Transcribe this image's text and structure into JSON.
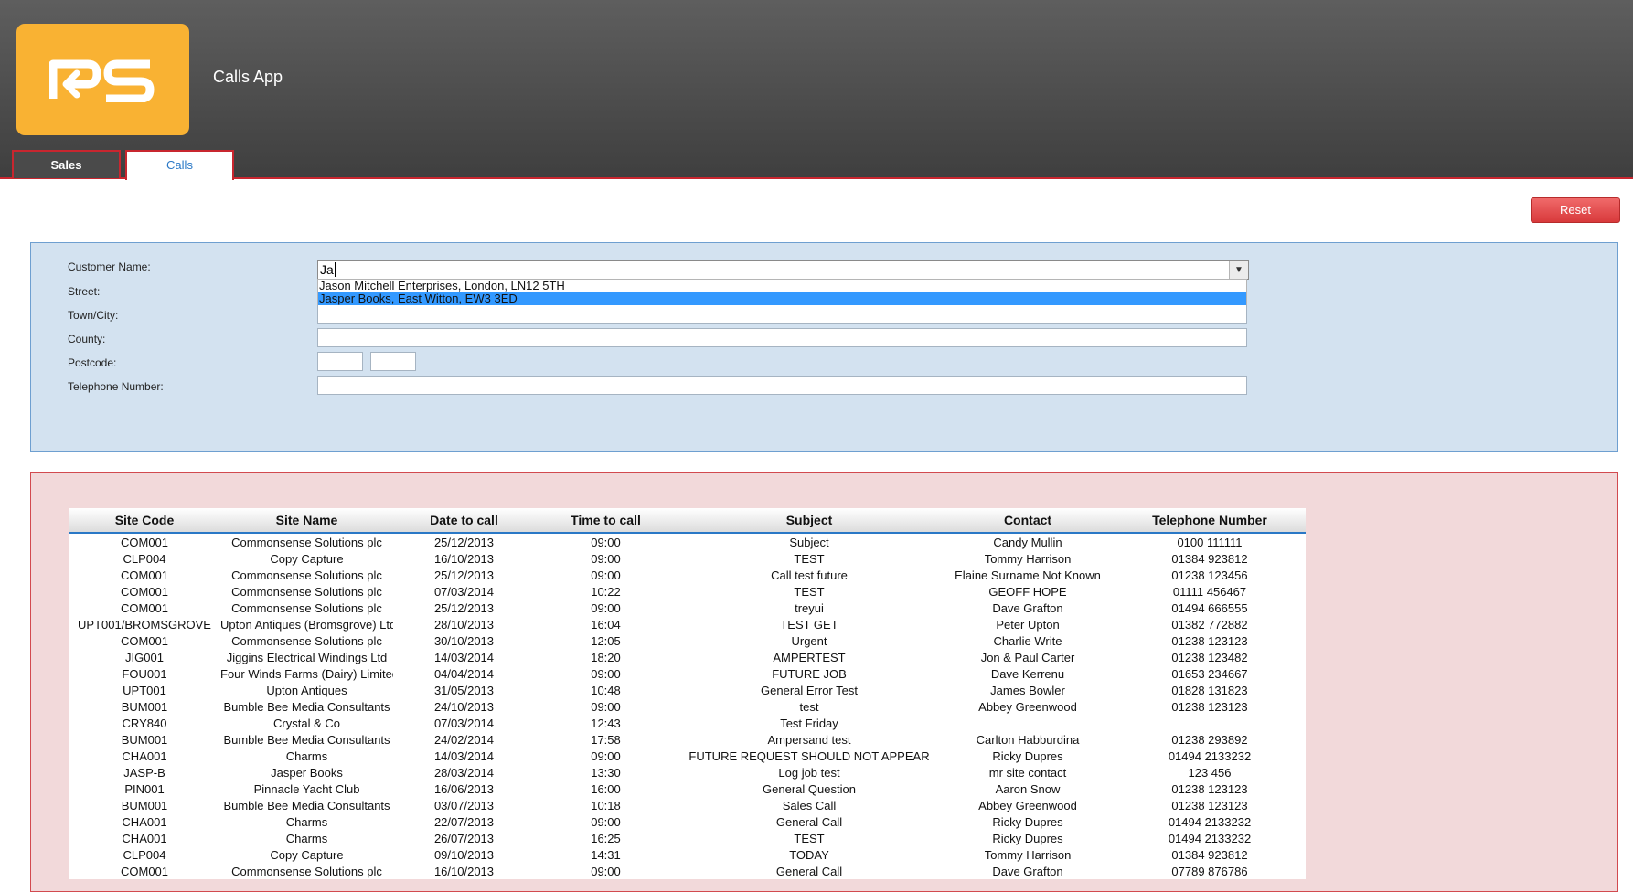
{
  "header": {
    "logo_text": "PS",
    "app_title": "Calls App",
    "brand_color": "#f9b233",
    "accent_color": "#c8262f"
  },
  "tabs": [
    {
      "label": "Sales",
      "active": false
    },
    {
      "label": "Calls",
      "active": true
    }
  ],
  "toolbar": {
    "reset_label": "Reset"
  },
  "form": {
    "customer_name_label": "Customer Name:",
    "customer_name_value": "Ja",
    "street_label": "Street:",
    "town_label": "Town/City:",
    "county_label": "County:",
    "postcode_label": "Postcode:",
    "telephone_label": "Telephone Number:",
    "dropdown_options": [
      {
        "text": "Jason Mitchell Enterprises, London, LN12 5TH",
        "selected": false
      },
      {
        "text": "Jasper Books, East Witton, EW3 3ED",
        "selected": true
      }
    ]
  },
  "table": {
    "columns": [
      "Site Code",
      "Site Name",
      "Date to call",
      "Time to call",
      "Subject",
      "Contact",
      "Telephone Number"
    ],
    "rows": [
      [
        "COM001",
        "Commonsense Solutions plc",
        "25/12/2013",
        "09:00",
        "Subject",
        "Candy Mullin",
        "0100 111111"
      ],
      [
        "CLP004",
        "Copy Capture",
        "16/10/2013",
        "09:00",
        "TEST",
        "Tommy Harrison",
        "01384 923812"
      ],
      [
        "COM001",
        "Commonsense Solutions plc",
        "25/12/2013",
        "09:00",
        "Call test future",
        "Elaine Surname Not Known",
        "01238 123456"
      ],
      [
        "COM001",
        "Commonsense Solutions plc",
        "07/03/2014",
        "10:22",
        "TEST",
        "GEOFF HOPE",
        "01111 456467"
      ],
      [
        "COM001",
        "Commonsense Solutions plc",
        "25/12/2013",
        "09:00",
        "treyui",
        "Dave Grafton",
        "01494 666555"
      ],
      [
        "UPT001/BROMSGROVE",
        "Upton Antiques (Bromsgrove) Ltd",
        "28/10/2013",
        "16:04",
        "TEST GET",
        "Peter Upton",
        "01382 772882"
      ],
      [
        "COM001",
        "Commonsense Solutions plc",
        "30/10/2013",
        "12:05",
        "Urgent",
        "Charlie Write",
        "01238 123123"
      ],
      [
        "JIG001",
        "Jiggins Electrical Windings Ltd",
        "14/03/2014",
        "18:20",
        "AMPERTEST",
        "Jon & Paul Carter",
        "01238 123482"
      ],
      [
        "FOU001",
        "Four Winds Farms (Dairy) Limited",
        "04/04/2014",
        "09:00",
        "FUTURE JOB",
        "Dave Kerrenu",
        "01653 234667"
      ],
      [
        "UPT001",
        "Upton Antiques",
        "31/05/2013",
        "10:48",
        "General Error Test",
        "James Bowler",
        "01828 131823"
      ],
      [
        "BUM001",
        "Bumble Bee Media Consultants",
        "24/10/2013",
        "09:00",
        "test",
        "Abbey Greenwood",
        "01238 123123"
      ],
      [
        "CRY840",
        "Crystal & Co",
        "07/03/2014",
        "12:43",
        "Test Friday",
        "",
        ""
      ],
      [
        "BUM001",
        "Bumble Bee Media Consultants",
        "24/02/2014",
        "17:58",
        "Ampersand test",
        "Carlton Habburdina",
        "01238 293892"
      ],
      [
        "CHA001",
        "Charms",
        "14/03/2014",
        "09:00",
        "FUTURE REQUEST SHOULD NOT APPEAR",
        "Ricky Dupres",
        "01494 2133232"
      ],
      [
        "JASP-B",
        "Jasper Books",
        "28/03/2014",
        "13:30",
        "Log job test",
        "mr site contact",
        "123 456"
      ],
      [
        "PIN001",
        "Pinnacle Yacht Club",
        "16/06/2013",
        "16:00",
        "General Question",
        "Aaron Snow",
        "01238 123123"
      ],
      [
        "BUM001",
        "Bumble Bee Media Consultants",
        "03/07/2013",
        "10:18",
        "Sales Call",
        "Abbey Greenwood",
        "01238 123123"
      ],
      [
        "CHA001",
        "Charms",
        "22/07/2013",
        "09:00",
        "General Call",
        "Ricky Dupres",
        "01494 2133232"
      ],
      [
        "CHA001",
        "Charms",
        "26/07/2013",
        "16:25",
        "TEST",
        "Ricky Dupres",
        "01494 2133232"
      ],
      [
        "CLP004",
        "Copy Capture",
        "09/10/2013",
        "14:31",
        "TODAY",
        "Tommy Harrison",
        "01384 923812"
      ],
      [
        "COM001",
        "Commonsense Solutions plc",
        "16/10/2013",
        "09:00",
        "General Call",
        "Dave Grafton",
        "07789 876786"
      ]
    ]
  }
}
